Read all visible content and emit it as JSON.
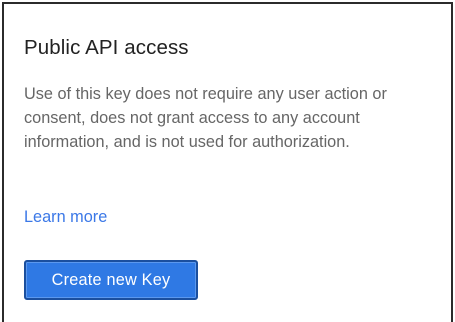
{
  "section": {
    "title": "Public API access",
    "description": "Use of this key does not require any user action or consent, does not grant access to any account information, and is not used for authorization.",
    "learn_more_label": "Learn more",
    "create_button_label": "Create new Key"
  },
  "colors": {
    "link": "#3b78e7",
    "button_bg": "#2f79e4",
    "button_border": "#1b4f9e",
    "title_text": "#222222",
    "body_text": "#666666",
    "panel_border": "#2b2b2b"
  }
}
